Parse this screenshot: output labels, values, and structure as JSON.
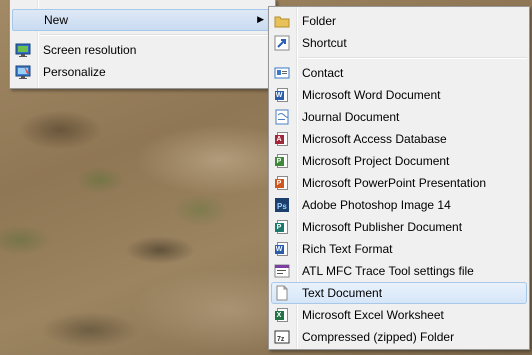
{
  "context_menu": {
    "items": [
      {
        "label": "New",
        "submenu_arrow": "▶"
      },
      {
        "label": "Screen resolution",
        "icon": "screen-resolution-icon"
      },
      {
        "label": "Personalize",
        "icon": "personalize-icon"
      }
    ]
  },
  "new_submenu": {
    "items": [
      {
        "label": "Folder",
        "icon": "folder-icon",
        "color": "#e8c15a"
      },
      {
        "label": "Shortcut",
        "icon": "shortcut-icon",
        "color": "#2a5fb8"
      },
      {
        "label": "Contact",
        "icon": "contact-icon",
        "color": "#3a78c8"
      },
      {
        "label": "Microsoft Word Document",
        "icon": "word-document-icon",
        "color": "#2b5caa"
      },
      {
        "label": "Journal Document",
        "icon": "journal-document-icon",
        "color": "#4a7fc0"
      },
      {
        "label": "Microsoft Access Database",
        "icon": "access-database-icon",
        "color": "#a3273a"
      },
      {
        "label": "Microsoft Project Document",
        "icon": "project-document-icon",
        "color": "#3f8a3a"
      },
      {
        "label": "Microsoft PowerPoint Presentation",
        "icon": "powerpoint-presentation-icon",
        "color": "#d0561f"
      },
      {
        "label": "Adobe Photoshop Image 14",
        "icon": "photoshop-image-icon",
        "color": "#1c3f6e"
      },
      {
        "label": "Microsoft Publisher Document",
        "icon": "publisher-document-icon",
        "color": "#1f7a6e"
      },
      {
        "label": "Rich Text Format",
        "icon": "rich-text-icon",
        "color": "#2b5caa"
      },
      {
        "label": "ATL MFC Trace Tool settings file",
        "icon": "trace-tool-icon",
        "color": "#7a3fa0"
      },
      {
        "label": "Text Document",
        "icon": "text-document-icon",
        "color": "#ffffff"
      },
      {
        "label": "Microsoft Excel Worksheet",
        "icon": "excel-worksheet-icon",
        "color": "#217346"
      },
      {
        "label": "Compressed (zipped) Folder",
        "icon": "zipped-folder-icon",
        "color": "#333333"
      }
    ]
  }
}
